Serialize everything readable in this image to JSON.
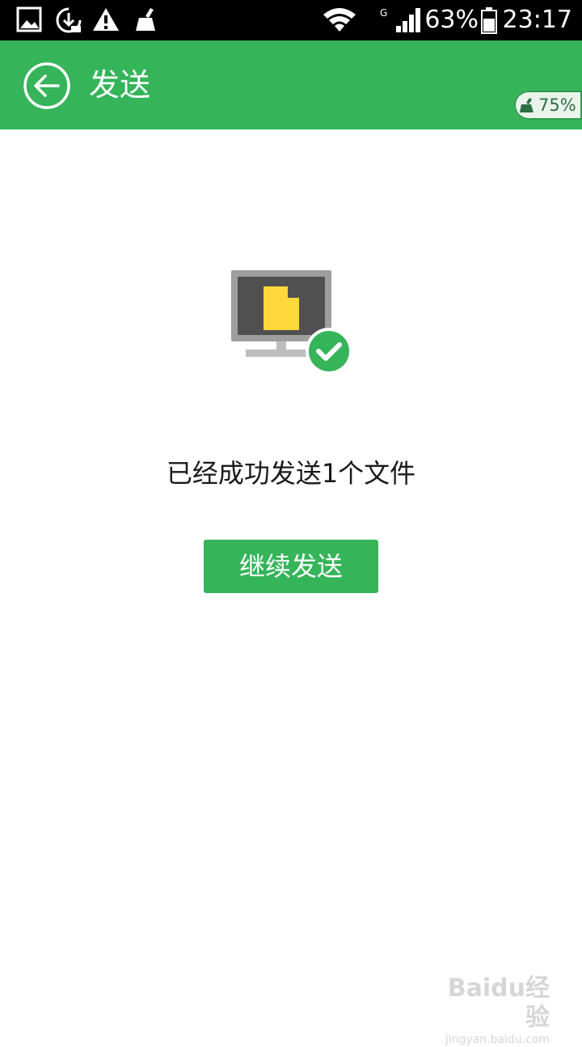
{
  "status_bar": {
    "battery_percent": "63%",
    "clock": "23:17",
    "icons": [
      "image-icon",
      "download-icon",
      "warning-icon",
      "broom-icon",
      "wifi-icon",
      "signal-g-icon",
      "battery-icon"
    ]
  },
  "app_bar": {
    "title": "发送",
    "back_icon": "back-arrow-icon",
    "clean_badge": {
      "icon": "broom-icon",
      "text": "75%"
    }
  },
  "main": {
    "illustration_icon": "monitor-file-sent-icon",
    "message": "已经成功发送1个文件",
    "continue_button_label": "继续发送"
  },
  "watermark": {
    "logo": "Baidu经验",
    "url": "jingyan.baidu.com"
  },
  "colors": {
    "accent": "#35b45a",
    "file": "#ffd83b",
    "monitor": "#9e9e9e",
    "screen": "#505050"
  }
}
